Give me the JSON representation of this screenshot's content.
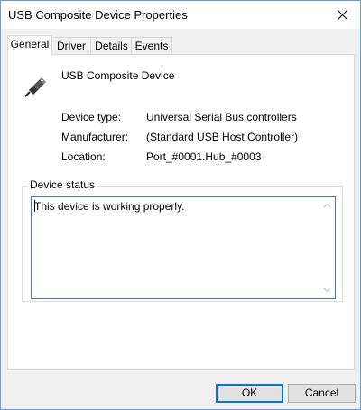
{
  "window": {
    "title": "USB Composite Device Properties"
  },
  "tabs": [
    {
      "label": "General",
      "active": true
    },
    {
      "label": "Driver",
      "active": false
    },
    {
      "label": "Details",
      "active": false
    },
    {
      "label": "Events",
      "active": false
    }
  ],
  "device": {
    "icon": "usb-connector-icon",
    "name": "USB Composite Device",
    "properties": [
      {
        "label": "Device type:",
        "value": "Universal Serial Bus controllers"
      },
      {
        "label": "Manufacturer:",
        "value": "(Standard USB Host Controller)"
      },
      {
        "label": "Location:",
        "value": "Port_#0001.Hub_#0003"
      }
    ]
  },
  "status": {
    "group_label": "Device status",
    "text": "This device is working properly."
  },
  "buttons": {
    "ok": "OK",
    "cancel": "Cancel"
  },
  "colors": {
    "accent": "#0078d7",
    "window_border": "#6b9ad6",
    "focus_border": "#3c7fb1"
  }
}
